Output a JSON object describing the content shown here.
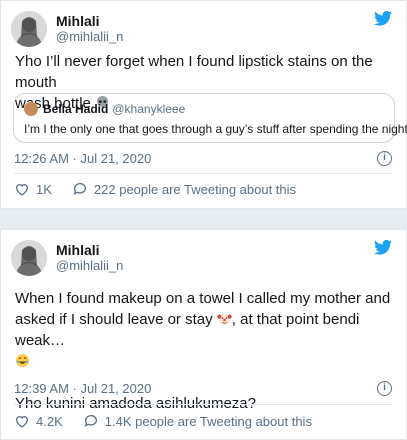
{
  "tweets": [
    {
      "display_name": "Mihlali",
      "handle": "@mihlalii_n",
      "text_line1": "Yho I’ll never forget when I found lipstick stains on the mouth",
      "text_line2": "wash bottle",
      "emoji_icon": "skull-icon",
      "quote": {
        "display_name": "Bella Hadid",
        "handle": "@khanykleee",
        "text": "I’m I the only one that goes through a guy’s stuff after spending the night ."
      },
      "timestamp": "12:26 AM · Jul 21, 2020",
      "likes": "1K",
      "tweeting_label": "222 people are Tweeting about this"
    },
    {
      "display_name": "Mihlali",
      "handle": "@mihlalii_n",
      "text_line1": "When I found makeup on a towel I called my mother and",
      "text_line2": "asked if I should leave or stay",
      "text_line2b": ", at that point bendi weak…",
      "emoji_icons": [
        "clown-icon",
        "rofl-icon"
      ],
      "text_line4": "Yho kunini amadoda asihlukumeza?",
      "timestamp": "12:39 AM · Jul 21, 2020",
      "likes": "4.2K",
      "tweeting_label": "1.4K people are Tweeting about this"
    }
  ],
  "colors": {
    "twitter_blue": "#1da1f2",
    "secondary_text": "#5b7083",
    "border": "#e1e8ed"
  }
}
